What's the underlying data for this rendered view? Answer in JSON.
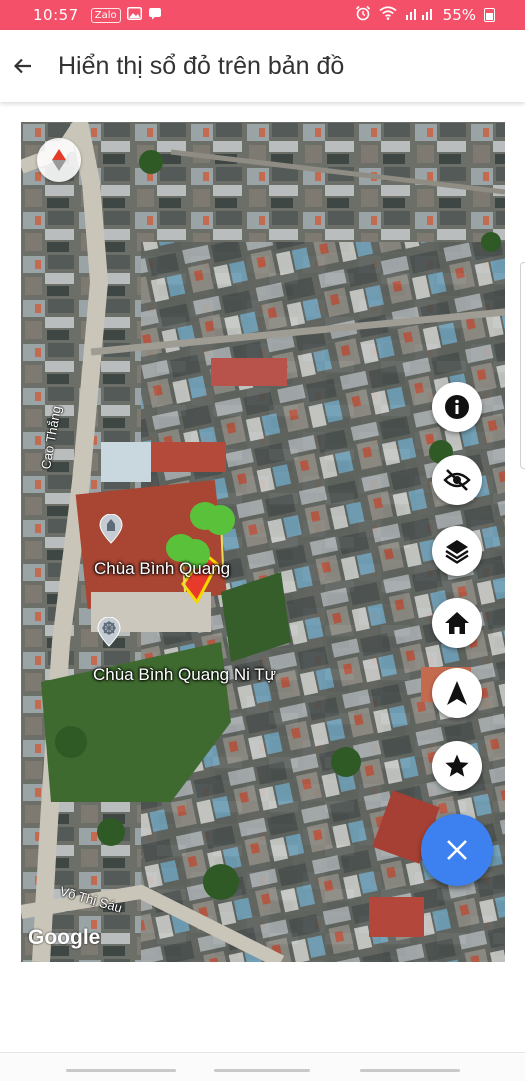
{
  "status_bar": {
    "time": "10:57",
    "zalo_label": "Zalo",
    "battery": "55%",
    "icons": [
      "zalo-icon",
      "image-icon",
      "message-icon",
      "alarm-icon",
      "wifi-icon",
      "signal-icon",
      "battery-icon"
    ],
    "background": "#f4506a"
  },
  "app_bar": {
    "title": "Hiển thị sổ đỏ trên bản đồ",
    "back_icon": "arrow-left-icon"
  },
  "map": {
    "type": "satellite",
    "roads": [
      "Cao Thắng",
      "Võ Thị Sáu"
    ],
    "places": [
      {
        "name": "Chùa Bình Quang",
        "icon": "temple-icon"
      },
      {
        "name": "Chùa Bình Quang Ni Tự",
        "icon": "dharma-wheel-icon"
      }
    ],
    "attribution": "Google",
    "parcel_color": "#e83a2a",
    "parcel_outline": "#f5d800"
  },
  "fab_buttons": [
    {
      "name": "info",
      "icon": "info-icon"
    },
    {
      "name": "visibility",
      "icon": "eye-off-icon"
    },
    {
      "name": "layers",
      "icon": "layers-icon"
    },
    {
      "name": "home",
      "icon": "home-icon"
    },
    {
      "name": "navigate",
      "icon": "navigation-arrow-icon"
    },
    {
      "name": "favorite",
      "icon": "star-icon"
    }
  ],
  "close_fab": {
    "icon": "close-icon",
    "color": "#3d81f0"
  }
}
